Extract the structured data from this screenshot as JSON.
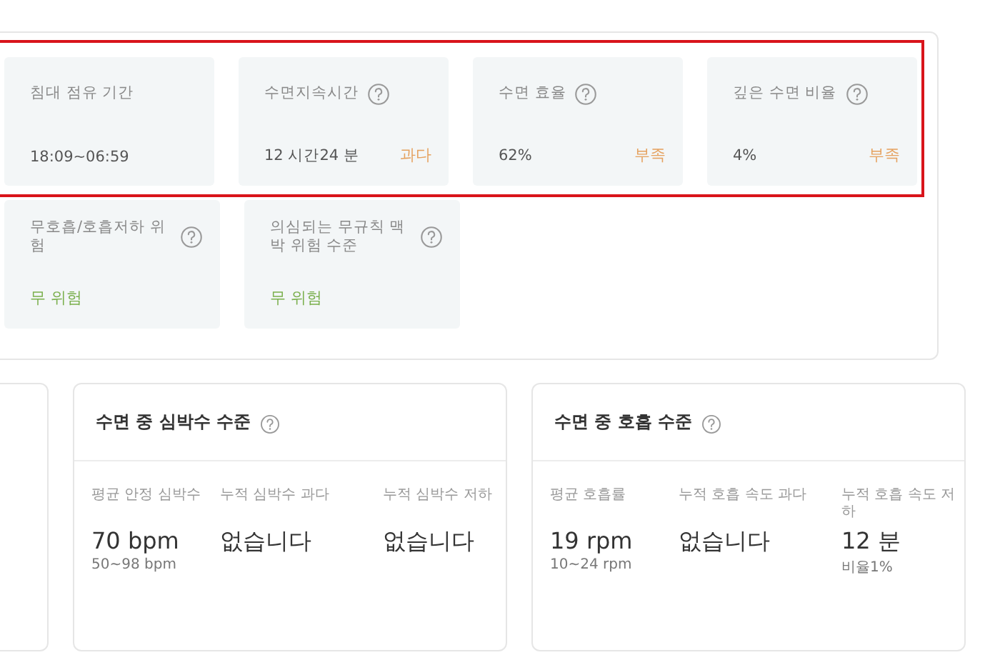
{
  "summary_rows": [
    {
      "highlighted": true,
      "tiles": [
        {
          "label": "침대 점유 기간",
          "help": false,
          "value": "18:09~06:59"
        },
        {
          "label": "수면지속시간",
          "help": true,
          "value": "12 시간24 분",
          "status": "과다",
          "kind": "warn"
        },
        {
          "label": "수면 효율",
          "help": true,
          "value": "62%",
          "status": "부족",
          "kind": "warn"
        },
        {
          "label": "깊은 수면 비율",
          "help": true,
          "value": "4%",
          "status": "부족",
          "kind": "warn"
        }
      ]
    },
    {
      "highlighted": false,
      "tiles": [
        {
          "label": "무호흡/호흡저하 위험",
          "help": true,
          "status": "무 위험",
          "kind": "ok"
        },
        {
          "label": "의심되는 무규칙 맥박 위험 수준",
          "help": true,
          "status": "무 위험",
          "kind": "ok"
        }
      ]
    }
  ],
  "cards": [
    {
      "title": "수면 중 심박수 수준",
      "help": true,
      "metrics": [
        {
          "label": "평균 안정 심박수",
          "value": "70 bpm",
          "sub": "50~98 bpm"
        },
        {
          "label": "누적 심박수 과다",
          "value": "없습니다"
        },
        {
          "label": "누적 심박수 저하",
          "value": "없습니다"
        }
      ]
    },
    {
      "title": "수면 중 호흡 수준",
      "help": true,
      "metrics": [
        {
          "label": "평균 호흡률",
          "value": "19 rpm",
          "sub": "10~24 rpm"
        },
        {
          "label": "누적 호흡 속도 과다",
          "value": "없습니다"
        },
        {
          "label": "누적 호흡 속도 저하",
          "value": "12 분",
          "sub": "비율1%"
        }
      ]
    }
  ]
}
